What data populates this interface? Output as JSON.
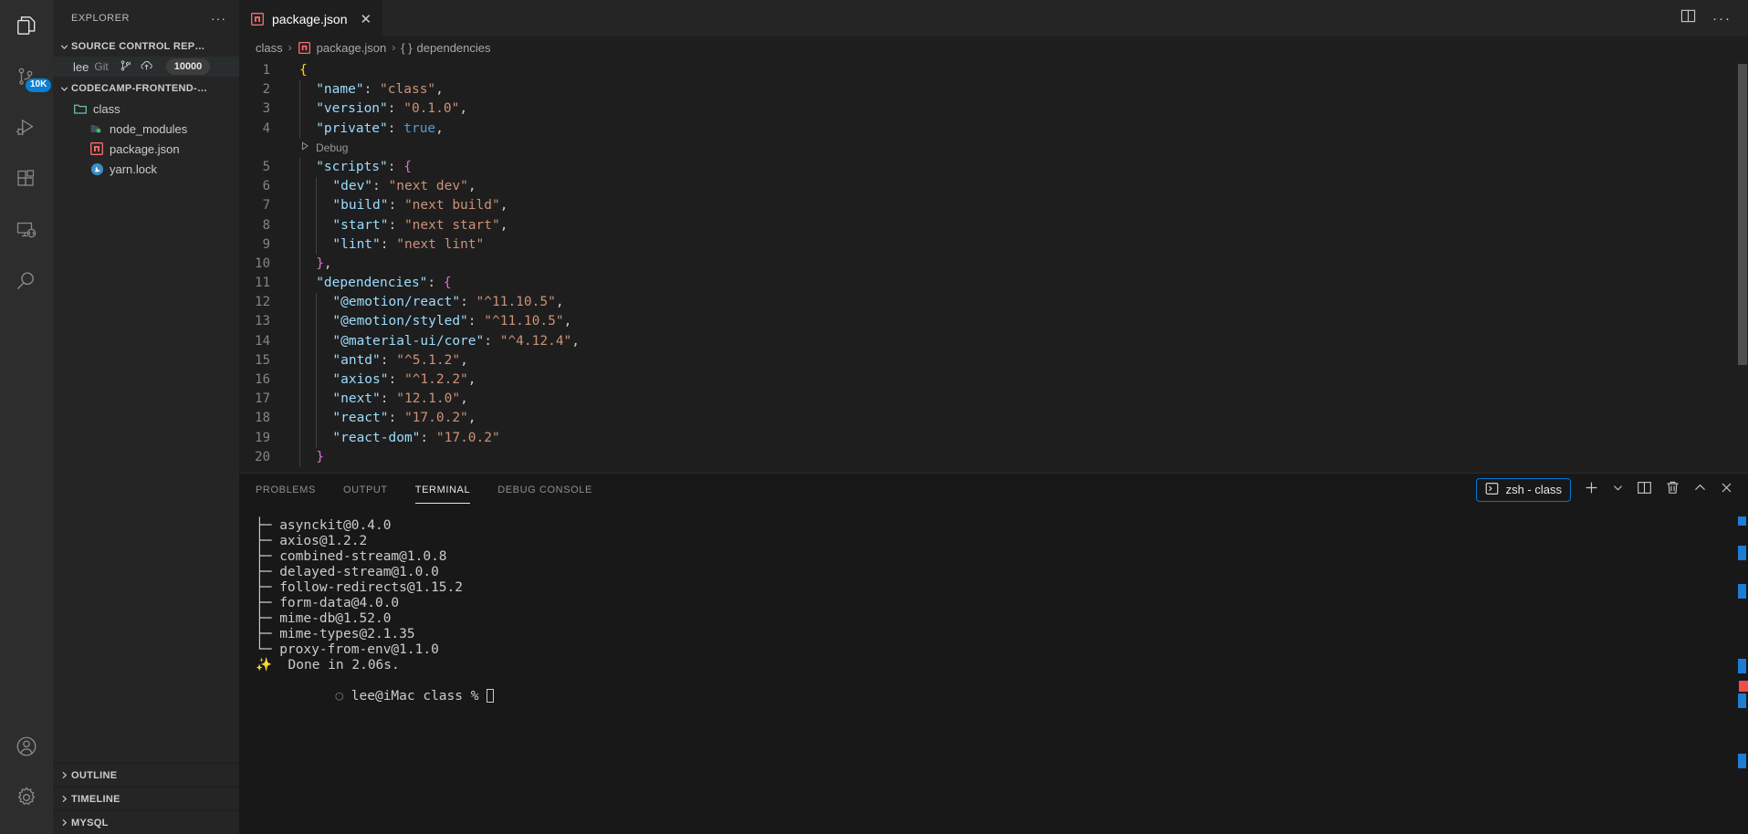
{
  "activitybar": {
    "items": [
      {
        "name": "explorer-icon",
        "label": "Explorer",
        "badge": ""
      },
      {
        "name": "source-control-icon",
        "label": "Source Control",
        "badge": "10K"
      },
      {
        "name": "run-and-debug-icon",
        "label": "Run and Debug",
        "badge": ""
      },
      {
        "name": "extensions-icon",
        "label": "Extensions",
        "badge": ""
      },
      {
        "name": "remote-explorer-icon",
        "label": "Remote Explorer",
        "badge": ""
      },
      {
        "name": "search-icon",
        "label": "Search",
        "badge": ""
      }
    ],
    "bottom": [
      {
        "name": "account-icon",
        "label": "Accounts"
      },
      {
        "name": "manage-gear-icon",
        "label": "Manage"
      }
    ]
  },
  "sidebar": {
    "title": "EXPLORER",
    "more_actions": "···",
    "source_control": {
      "header": "SOURCE CONTROL REP…",
      "repo_name": "lee",
      "repo_desc": "Git",
      "branch": "",
      "count": "10000"
    },
    "project": {
      "header": "CODECAMP-FRONTEND-…",
      "items": [
        {
          "label": "class",
          "icon": "folder-icon",
          "indent": 1
        },
        {
          "label": "node_modules",
          "icon": "node-modules-folder-icon",
          "indent": 2
        },
        {
          "label": "package.json",
          "icon": "npm-file-icon",
          "indent": 2
        },
        {
          "label": "yarn.lock",
          "icon": "yarn-file-icon",
          "indent": 2
        }
      ]
    },
    "bottom_sections": [
      {
        "label": "OUTLINE"
      },
      {
        "label": "TIMELINE"
      },
      {
        "label": "MYSQL"
      }
    ]
  },
  "editor": {
    "tab": {
      "label": "package.json",
      "icon": "npm-file-icon",
      "close": "✕"
    },
    "actions": [
      {
        "name": "split-editor-icon",
        "label": "Split Editor Right"
      },
      {
        "name": "more-actions-icon",
        "label": "···"
      }
    ],
    "breadcrumbs": [
      {
        "label": "class",
        "icon": ""
      },
      {
        "label": "package.json",
        "icon": "npm-file-icon"
      },
      {
        "label": "dependencies",
        "icon": "braces-icon"
      }
    ],
    "breadcrumb_separator": "›",
    "codelens": {
      "label": "Debug",
      "icon": "run-triangle-icon"
    },
    "lines": [
      {
        "n": "1",
        "tokens": [
          {
            "t": "{",
            "c": "b1"
          }
        ],
        "indent": 0
      },
      {
        "n": "2",
        "tokens": [
          {
            "t": "\"name\"",
            "c": "k"
          },
          {
            "t": ": ",
            "c": "p"
          },
          {
            "t": "\"class\"",
            "c": "s"
          },
          {
            "t": ",",
            "c": "p"
          }
        ],
        "indent": 1
      },
      {
        "n": "3",
        "tokens": [
          {
            "t": "\"version\"",
            "c": "k"
          },
          {
            "t": ": ",
            "c": "p"
          },
          {
            "t": "\"0.1.0\"",
            "c": "s"
          },
          {
            "t": ",",
            "c": "p"
          }
        ],
        "indent": 1
      },
      {
        "n": "4",
        "tokens": [
          {
            "t": "\"private\"",
            "c": "k"
          },
          {
            "t": ": ",
            "c": "p"
          },
          {
            "t": "true",
            "c": "kw"
          },
          {
            "t": ",",
            "c": "p"
          }
        ],
        "indent": 1
      },
      {
        "n": "5",
        "tokens": [
          {
            "t": "\"scripts\"",
            "c": "k"
          },
          {
            "t": ": ",
            "c": "p"
          },
          {
            "t": "{",
            "c": "b2"
          }
        ],
        "indent": 1
      },
      {
        "n": "6",
        "tokens": [
          {
            "t": "\"dev\"",
            "c": "k"
          },
          {
            "t": ": ",
            "c": "p"
          },
          {
            "t": "\"next dev\"",
            "c": "s"
          },
          {
            "t": ",",
            "c": "p"
          }
        ],
        "indent": 2
      },
      {
        "n": "7",
        "tokens": [
          {
            "t": "\"build\"",
            "c": "k"
          },
          {
            "t": ": ",
            "c": "p"
          },
          {
            "t": "\"next build\"",
            "c": "s"
          },
          {
            "t": ",",
            "c": "p"
          }
        ],
        "indent": 2
      },
      {
        "n": "8",
        "tokens": [
          {
            "t": "\"start\"",
            "c": "k"
          },
          {
            "t": ": ",
            "c": "p"
          },
          {
            "t": "\"next start\"",
            "c": "s"
          },
          {
            "t": ",",
            "c": "p"
          }
        ],
        "indent": 2
      },
      {
        "n": "9",
        "tokens": [
          {
            "t": "\"lint\"",
            "c": "k"
          },
          {
            "t": ": ",
            "c": "p"
          },
          {
            "t": "\"next lint\"",
            "c": "s"
          }
        ],
        "indent": 2
      },
      {
        "n": "10",
        "tokens": [
          {
            "t": "}",
            "c": "b2"
          },
          {
            "t": ",",
            "c": "p"
          }
        ],
        "indent": 1
      },
      {
        "n": "11",
        "tokens": [
          {
            "t": "\"dependencies\"",
            "c": "k"
          },
          {
            "t": ": ",
            "c": "p"
          },
          {
            "t": "{",
            "c": "b2"
          }
        ],
        "indent": 1
      },
      {
        "n": "12",
        "tokens": [
          {
            "t": "\"@emotion/react\"",
            "c": "k"
          },
          {
            "t": ": ",
            "c": "p"
          },
          {
            "t": "\"^11.10.5\"",
            "c": "s"
          },
          {
            "t": ",",
            "c": "p"
          }
        ],
        "indent": 2
      },
      {
        "n": "13",
        "tokens": [
          {
            "t": "\"@emotion/styled\"",
            "c": "k"
          },
          {
            "t": ": ",
            "c": "p"
          },
          {
            "t": "\"^11.10.5\"",
            "c": "s"
          },
          {
            "t": ",",
            "c": "p"
          }
        ],
        "indent": 2
      },
      {
        "n": "14",
        "tokens": [
          {
            "t": "\"@material-ui/core\"",
            "c": "k"
          },
          {
            "t": ": ",
            "c": "p"
          },
          {
            "t": "\"^4.12.4\"",
            "c": "s"
          },
          {
            "t": ",",
            "c": "p"
          }
        ],
        "indent": 2
      },
      {
        "n": "15",
        "tokens": [
          {
            "t": "\"antd\"",
            "c": "k"
          },
          {
            "t": ": ",
            "c": "p"
          },
          {
            "t": "\"^5.1.2\"",
            "c": "s"
          },
          {
            "t": ",",
            "c": "p"
          }
        ],
        "indent": 2
      },
      {
        "n": "16",
        "tokens": [
          {
            "t": "\"axios\"",
            "c": "k"
          },
          {
            "t": ": ",
            "c": "p"
          },
          {
            "t": "\"^1.2.2\"",
            "c": "s"
          },
          {
            "t": ",",
            "c": "p"
          }
        ],
        "indent": 2
      },
      {
        "n": "17",
        "tokens": [
          {
            "t": "\"next\"",
            "c": "k"
          },
          {
            "t": ": ",
            "c": "p"
          },
          {
            "t": "\"12.1.0\"",
            "c": "s"
          },
          {
            "t": ",",
            "c": "p"
          }
        ],
        "indent": 2
      },
      {
        "n": "18",
        "tokens": [
          {
            "t": "\"react\"",
            "c": "k"
          },
          {
            "t": ": ",
            "c": "p"
          },
          {
            "t": "\"17.0.2\"",
            "c": "s"
          },
          {
            "t": ",",
            "c": "p"
          }
        ],
        "indent": 2
      },
      {
        "n": "19",
        "tokens": [
          {
            "t": "\"react-dom\"",
            "c": "k"
          },
          {
            "t": ": ",
            "c": "p"
          },
          {
            "t": "\"17.0.2\"",
            "c": "s"
          }
        ],
        "indent": 2
      },
      {
        "n": "20",
        "tokens": [
          {
            "t": "}",
            "c": "b2"
          }
        ],
        "indent": 1
      }
    ]
  },
  "panel": {
    "tabs": [
      {
        "label": "PROBLEMS",
        "active": false
      },
      {
        "label": "OUTPUT",
        "active": false
      },
      {
        "label": "TERMINAL",
        "active": true
      },
      {
        "label": "DEBUG CONSOLE",
        "active": false
      }
    ],
    "terminal_chip": {
      "label": "zsh - class",
      "icon": "terminal-icon"
    },
    "actions": [
      {
        "name": "new-terminal-icon",
        "label": "+"
      },
      {
        "name": "chevron-down-icon",
        "label": "∨"
      },
      {
        "name": "split-terminal-icon",
        "label": "Split"
      },
      {
        "name": "kill-terminal-icon",
        "label": "Trash"
      },
      {
        "name": "maximize-panel-icon",
        "label": "∧"
      },
      {
        "name": "close-panel-icon",
        "label": "✕"
      }
    ],
    "terminal_lines": [
      {
        "prefix": "├─ ",
        "text": "asynckit@0.4.0",
        "kind": "tree"
      },
      {
        "prefix": "├─ ",
        "text": "axios@1.2.2",
        "kind": "tree"
      },
      {
        "prefix": "├─ ",
        "text": "combined-stream@1.0.8",
        "kind": "tree"
      },
      {
        "prefix": "├─ ",
        "text": "delayed-stream@1.0.0",
        "kind": "tree"
      },
      {
        "prefix": "├─ ",
        "text": "follow-redirects@1.15.2",
        "kind": "tree"
      },
      {
        "prefix": "├─ ",
        "text": "form-data@4.0.0",
        "kind": "tree"
      },
      {
        "prefix": "├─ ",
        "text": "mime-db@1.52.0",
        "kind": "tree"
      },
      {
        "prefix": "├─ ",
        "text": "mime-types@2.1.35",
        "kind": "tree"
      },
      {
        "prefix": "└─ ",
        "text": "proxy-from-env@1.1.0",
        "kind": "tree"
      },
      {
        "prefix": "✨  ",
        "text": "Done in 2.06s.",
        "kind": "done"
      }
    ],
    "prompt": {
      "marker": "○ ",
      "text": "lee@iMac class % "
    }
  }
}
